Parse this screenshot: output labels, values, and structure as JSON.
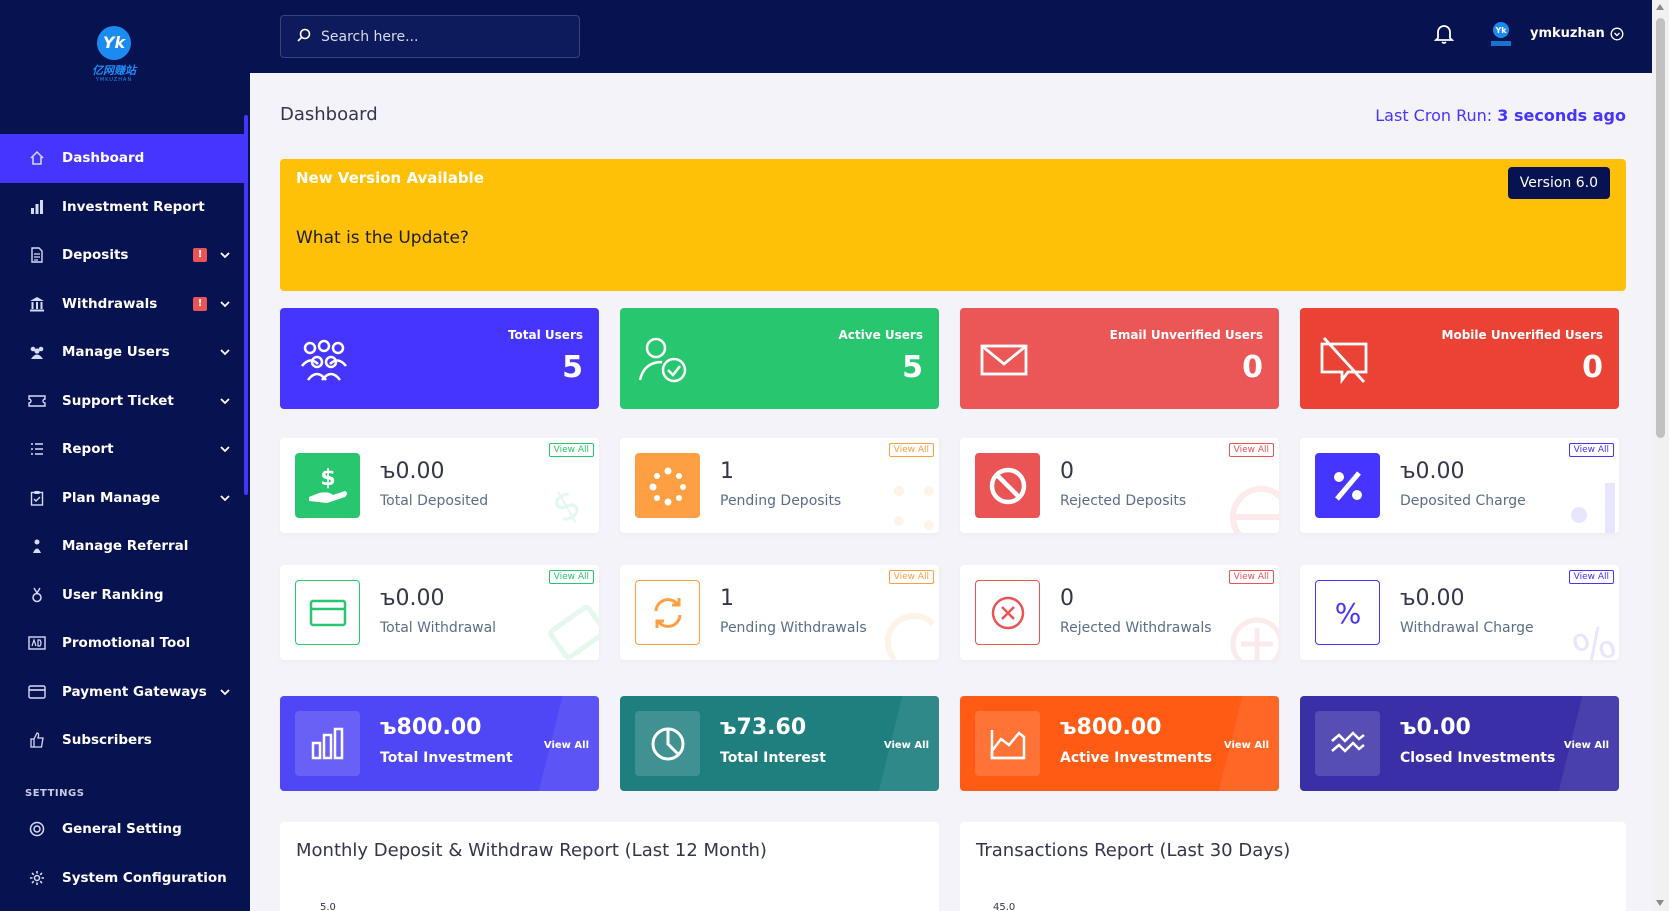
{
  "brand": {
    "mark": "Yk",
    "name": "亿网赚站",
    "sub": "YMKUZHAN"
  },
  "search": {
    "placeholder": "Search here..."
  },
  "user": {
    "name": "ymkuzhan"
  },
  "sidebar": {
    "items": [
      {
        "label": "Dashboard",
        "icon": "home-icon",
        "active": true
      },
      {
        "label": "Investment Report",
        "icon": "bar-chart-icon"
      },
      {
        "label": "Deposits",
        "icon": "file-money-icon",
        "badge": "!",
        "dropdown": true
      },
      {
        "label": "Withdrawals",
        "icon": "bank-icon",
        "badge": "!",
        "dropdown": true
      },
      {
        "label": "Manage Users",
        "icon": "users-icon",
        "dropdown": true
      },
      {
        "label": "Support Ticket",
        "icon": "ticket-icon",
        "dropdown": true
      },
      {
        "label": "Report",
        "icon": "list-icon",
        "dropdown": true
      },
      {
        "label": "Plan Manage",
        "icon": "clipboard-icon",
        "dropdown": true
      },
      {
        "label": "Manage Referral",
        "icon": "referral-icon"
      },
      {
        "label": "User Ranking",
        "icon": "medal-icon"
      },
      {
        "label": "Promotional Tool",
        "icon": "ad-icon"
      },
      {
        "label": "Payment Gateways",
        "icon": "credit-card-icon",
        "dropdown": true
      },
      {
        "label": "Subscribers",
        "icon": "thumbs-up-icon"
      }
    ],
    "settings_label": "SETTINGS",
    "settings_items": [
      {
        "label": "General Setting",
        "icon": "life-ring-icon"
      },
      {
        "label": "System Configuration",
        "icon": "gear-icon"
      }
    ]
  },
  "header": {
    "title": "Dashboard",
    "cron_label": "Last Cron Run:",
    "cron_value": "3 seconds ago"
  },
  "banner": {
    "title": "New Version Available",
    "question": "What is the Update?",
    "version": "Version 6.0"
  },
  "stats": [
    {
      "label": "Total Users",
      "value": "5",
      "color": "#4634ff",
      "icon": "users-group-icon"
    },
    {
      "label": "Active Users",
      "value": "5",
      "color": "#28c76f",
      "icon": "user-check-icon"
    },
    {
      "label": "Email Unverified Users",
      "value": "0",
      "color": "#eb5757",
      "icon": "envelope-icon"
    },
    {
      "label": "Mobile Unverified Users",
      "value": "0",
      "color": "#ea4335",
      "icon": "mobile-slash-icon"
    }
  ],
  "deposits": [
    {
      "value": "ъ0.00",
      "label": "Total Deposited",
      "color": "#28c76f",
      "icon": "hand-money-icon",
      "view": "View All"
    },
    {
      "value": "1",
      "label": "Pending Deposits",
      "color": "#ff9f43",
      "icon": "spinner-icon",
      "view": "View All"
    },
    {
      "value": "0",
      "label": "Rejected Deposits",
      "color": "#ea5455",
      "icon": "ban-icon",
      "view": "View All"
    },
    {
      "value": "ъ0.00",
      "label": "Deposited Charge",
      "color": "#4634ff",
      "icon": "percent-icon",
      "view": "View All"
    }
  ],
  "withdrawals": [
    {
      "value": "ъ0.00",
      "label": "Total Withdrawal",
      "color": "#28c76f",
      "icon": "credit-card-icon",
      "view": "View All"
    },
    {
      "value": "1",
      "label": "Pending Withdrawals",
      "color": "#ff9f43",
      "icon": "sync-icon",
      "view": "View All"
    },
    {
      "value": "0",
      "label": "Rejected Withdrawals",
      "color": "#ea5455",
      "icon": "x-circle-icon",
      "view": "View All"
    },
    {
      "value": "ъ0.00",
      "label": "Withdrawal Charge",
      "color": "#4634ff",
      "icon": "percent-icon",
      "view": "View All"
    }
  ],
  "investments": [
    {
      "value": "ъ800.00",
      "label": "Total Investment",
      "color": "#4f46f5",
      "icon": "bar-chart-icon",
      "view": "View All"
    },
    {
      "value": "ъ73.60",
      "label": "Total Interest",
      "color": "#1f7f7f",
      "icon": "pie-chart-icon",
      "view": "View All"
    },
    {
      "value": "ъ800.00",
      "label": "Active Investments",
      "color": "#ff5b14",
      "icon": "area-chart-icon",
      "view": "View All"
    },
    {
      "value": "ъ0.00",
      "label": "Closed Investments",
      "color": "#3a2fa7",
      "icon": "wave-icon",
      "view": "View All"
    }
  ],
  "panels": [
    {
      "title": "Monthly Deposit & Withdraw Report (Last 12 Month)",
      "axis_top": "5.0"
    },
    {
      "title": "Transactions Report (Last 30 Days)",
      "axis_top": "45.0"
    }
  ]
}
